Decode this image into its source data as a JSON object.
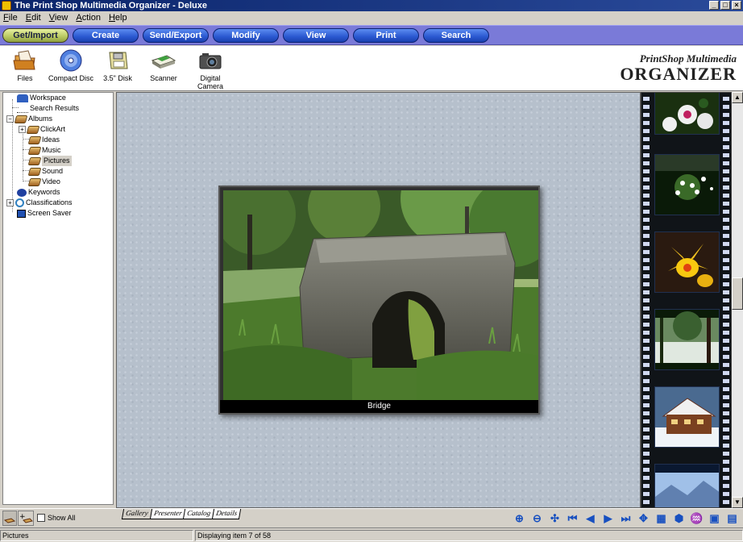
{
  "window": {
    "title": "The Print Shop Multimedia Organizer - Deluxe"
  },
  "menu": [
    "File",
    "Edit",
    "View",
    "Action",
    "Help"
  ],
  "nav": [
    "Get/Import",
    "Create",
    "Send/Export",
    "Modify",
    "View",
    "Print",
    "Search"
  ],
  "toolbar": {
    "files": "Files",
    "cd": "Compact Disc",
    "disk": "3.5\" Disk",
    "scanner": "Scanner",
    "camera1": "Digital",
    "camera2": "Camera"
  },
  "brand": {
    "line1": "PrintShop Multimedia",
    "line2": "ORGANIZER"
  },
  "tree": {
    "workspace": "Workspace",
    "search_results": "Search Results",
    "albums": "Albums",
    "clipart": "ClickArt",
    "ideas": "Ideas",
    "music": "Music",
    "pictures": "Pictures",
    "sound": "Sound",
    "video": "Video",
    "keywords": "Keywords",
    "classifications": "Classifications",
    "screensaver": "Screen Saver"
  },
  "viewer": {
    "caption": "Bridge"
  },
  "filmstrip": [
    "white-flowers",
    "white-blossoms",
    "yellow-orchid",
    "snowy-forest",
    "chalet-in-snow",
    "mountain-landscape"
  ],
  "bottom": {
    "show_all": "Show All",
    "tabs": [
      "Gallery",
      "Presenter",
      "Catalog",
      "Details"
    ],
    "active_tab": "Gallery"
  },
  "status": {
    "left": "Pictures",
    "center": "Displaying item 7 of 58"
  },
  "colors": {
    "navbar": "#7a7ad8",
    "nav_button": "#2a58d0",
    "titlebar": "#0a246a"
  }
}
